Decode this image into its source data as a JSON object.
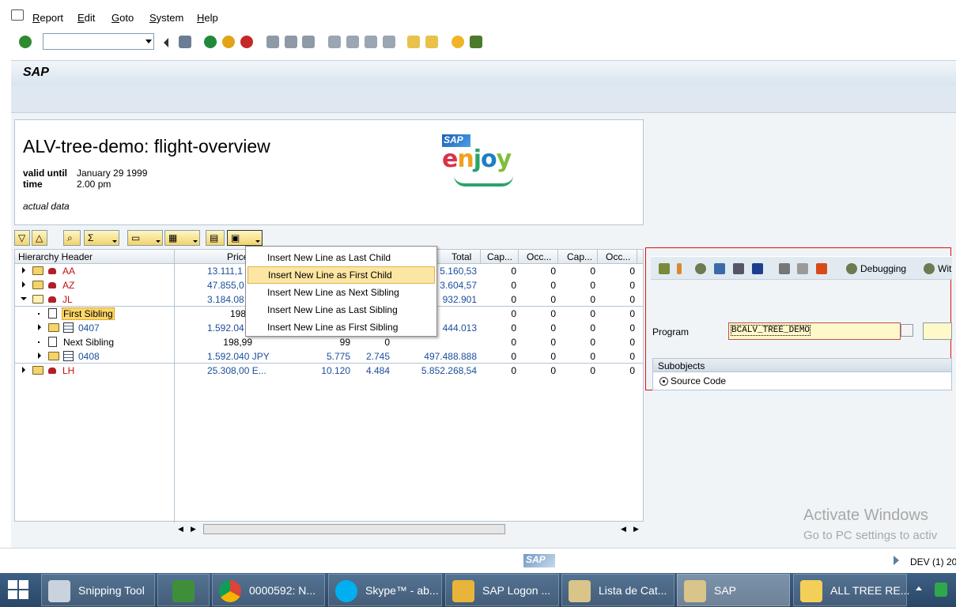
{
  "menu": {
    "items": [
      "Report",
      "Edit",
      "Goto",
      "System",
      "Help"
    ]
  },
  "toolbar": {
    "command_field_value": ""
  },
  "titlebar": {
    "title": "SAP"
  },
  "header": {
    "title": "ALV-tree-demo: flight-overview",
    "valid_until_label": "valid until",
    "valid_until_value": "January 29 1999",
    "time_label": "time",
    "time_value": "2.00 pm",
    "note": "actual data",
    "logo_sap": "SAP",
    "logo_text": "enjoy"
  },
  "tree": {
    "columns": [
      "Hierarchy Header",
      "Price",
      "",
      "",
      "Total",
      "Cap...",
      "Occ...",
      "Cap...",
      "Occ..."
    ],
    "rows": [
      {
        "label": "AA",
        "price": "13.111,1",
        "c2": "",
        "c3": "",
        "total": "5.160,53",
        "cap1": "0",
        "occ1": "0",
        "cap2": "0",
        "occ2": "0"
      },
      {
        "label": "AZ",
        "price": "47.855,0",
        "c2": "",
        "c3": "",
        "total": "3.604,57",
        "cap1": "0",
        "occ1": "0",
        "cap2": "0",
        "occ2": "0"
      },
      {
        "label": "JL",
        "price": "3.184.08",
        "c2": "",
        "c3": "",
        "total": "932.901",
        "cap1": "0",
        "occ1": "0",
        "cap2": "0",
        "occ2": "0"
      },
      {
        "label": "First Sibling",
        "price": "198,9",
        "c2": "",
        "c3": "",
        "total": "",
        "cap1": "0",
        "occ1": "0",
        "cap2": "0",
        "occ2": "0"
      },
      {
        "label": "0407",
        "price": "1.592.04",
        "c2": "",
        "c3": "",
        "total": "444.013",
        "cap1": "0",
        "occ1": "0",
        "cap2": "0",
        "occ2": "0"
      },
      {
        "label": "Next Sibling",
        "price": "198,99",
        "c2": "99",
        "c3": "0",
        "total": "",
        "cap1": "0",
        "occ1": "0",
        "cap2": "0",
        "occ2": "0"
      },
      {
        "label": "0408",
        "price": "1.592.040 JPY",
        "c2": "5.775",
        "c3": "2.745",
        "total": "497.488.888",
        "cap1": "0",
        "occ1": "0",
        "cap2": "0",
        "occ2": "0"
      },
      {
        "label": "LH",
        "price": "25.308,00 E...",
        "c2": "10.120",
        "c3": "4.484",
        "total": "5.852.268,54",
        "cap1": "0",
        "occ1": "0",
        "cap2": "0",
        "occ2": "0"
      }
    ]
  },
  "context_menu": {
    "items": [
      "Insert New Line as Last Child",
      "Insert New Line as First Child",
      "Insert New Line as Next Sibling",
      "Insert New Line as Last Sibling",
      "Insert New Line as First Sibling"
    ],
    "highlighted_index": 1
  },
  "right_panel": {
    "debugging_label": "Debugging",
    "with_label": "Wit",
    "program_label": "Program",
    "program_value": "BCALV_TREE_DEMO",
    "subobjects_label": "Subobjects",
    "source_code_label": "Source Code"
  },
  "watermark": {
    "line1": "Activate Windows",
    "line2": "Go to PC settings to activ"
  },
  "statusbar": {
    "sap_logo": "SAP",
    "system": "DEV (1) 20"
  },
  "taskbar": {
    "tasks": [
      "Snipping Tool",
      "",
      "0000592: N...",
      "Skype™ - ab...",
      "SAP Logon ...",
      "Lista de Cat...",
      "SAP",
      "ALL TREE RE..."
    ]
  }
}
